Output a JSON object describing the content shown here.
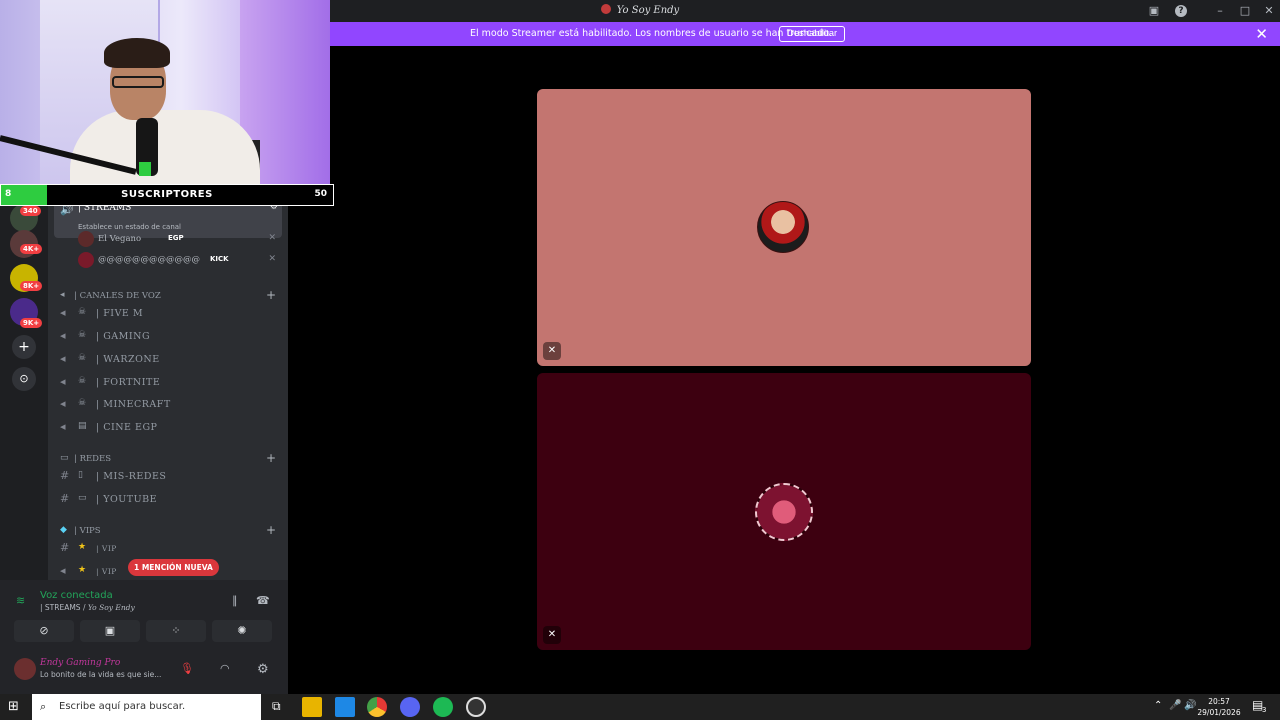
{
  "window": {
    "title": "Yo Soy Endy"
  },
  "banner": {
    "message": "El modo Streamer está habilitado. Los nombres de usuario se han truncado.",
    "button_label": "Deshabilitar"
  },
  "overlay": {
    "subs_current": "8",
    "subs_label": "SUSCRIPTORES",
    "subs_goal": "50",
    "subs_progress": 0.14
  },
  "rail": {
    "badges": [
      "340",
      "4K+",
      "8K+",
      "9K+"
    ]
  },
  "active_channel": {
    "name": "| STREAMS",
    "status": "Establece un estado de canal"
  },
  "members": [
    {
      "name": "El Vegano",
      "tag": "EGP"
    },
    {
      "name": "@@@@@@@@@@@@",
      "tag": "KICK"
    }
  ],
  "categories": {
    "voz": "| CANALES DE VOZ",
    "redes": "| REDES",
    "vips": "| VIPS"
  },
  "voice_channels": [
    "| FIVE M",
    "|  GAMING",
    "| WARZONE",
    "| FORTNITE",
    "| MINECRAFT",
    "| CINE EGP"
  ],
  "text_channels": [
    "| MIS-REDES",
    "| YOUTUBE"
  ],
  "vip_channels": [
    "| VIP",
    "| VIP"
  ],
  "mention_pill": "1 MENCIÓN NUEVA",
  "voice": {
    "status": "Voz conectada",
    "channel": "| STREAMS / ",
    "server": "Yo Soy Endy"
  },
  "user": {
    "name": "Endy Gaming Pro",
    "status": "Lo bonito de la vida es que sie..."
  },
  "taskbar": {
    "search_placeholder": "Escribe aquí para buscar.",
    "time": "20:57",
    "date": "29/01/2026",
    "notif_count": "3"
  },
  "colors": {
    "accent": "#9146ff",
    "tile1": "#c37570",
    "tile2": "#3d0010",
    "connected": "#23a55a"
  }
}
